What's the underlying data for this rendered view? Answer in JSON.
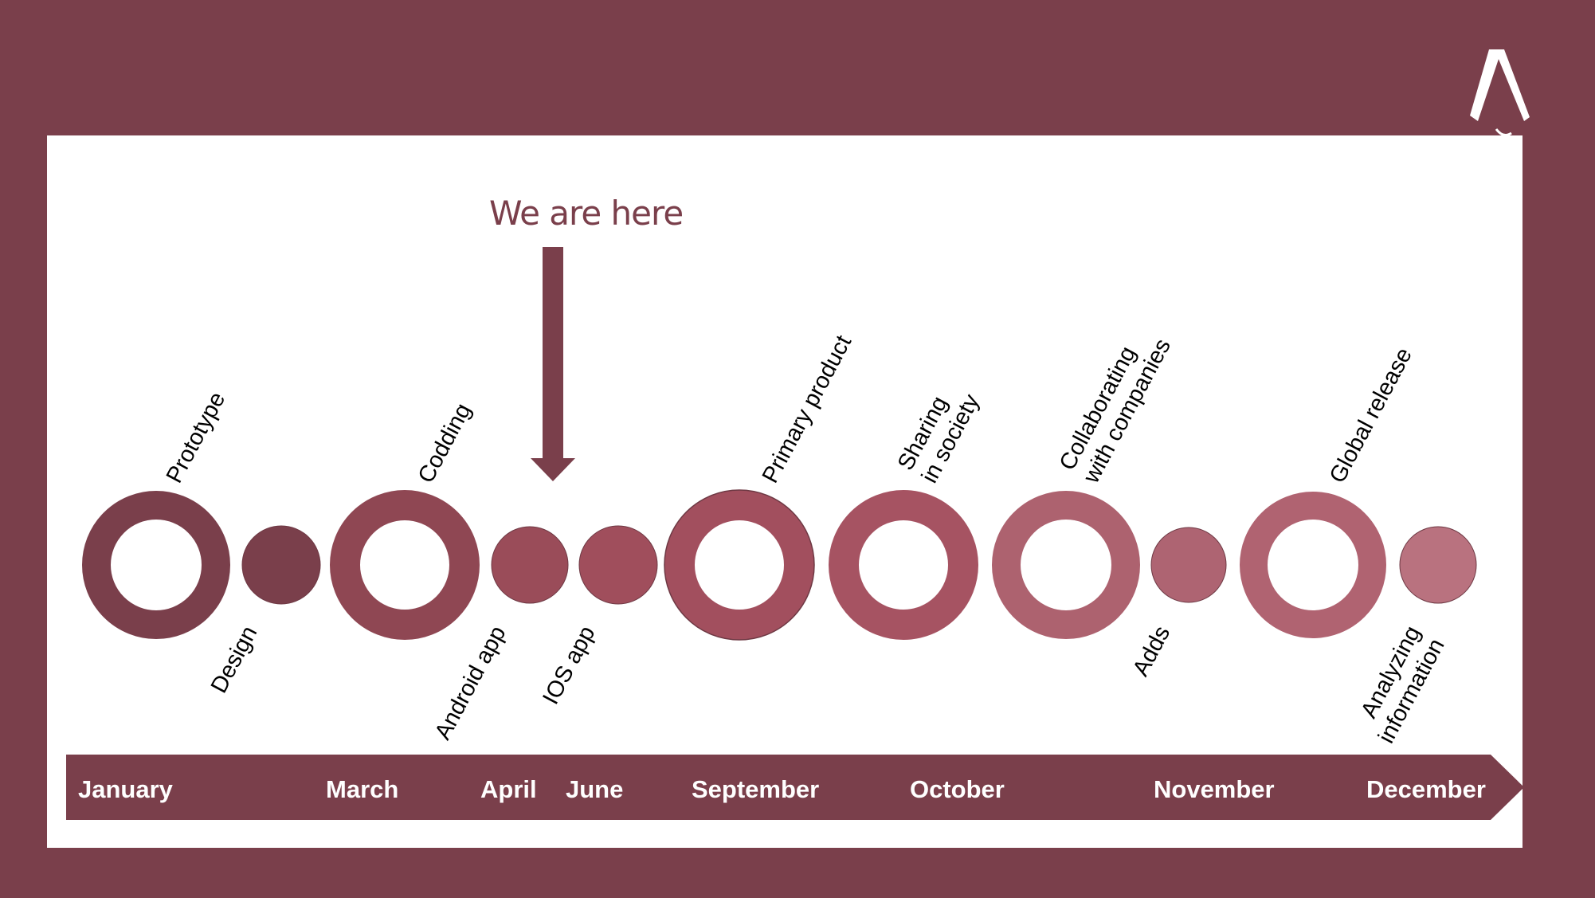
{
  "annotation": {
    "label": "We are here"
  },
  "stages": [
    {
      "name": "Prototype",
      "type": "milestone",
      "label_position": "above",
      "color": "#7a3f4b"
    },
    {
      "name": "Design",
      "type": "step",
      "label_position": "below",
      "color": "#7a3f4b"
    },
    {
      "name": "Codding",
      "type": "milestone",
      "label_position": "above",
      "color": "#8f4753"
    },
    {
      "name": "Android app",
      "type": "step",
      "label_position": "below",
      "color": "#9a4c59"
    },
    {
      "name": "IOS app",
      "type": "step",
      "label_position": "below",
      "color": "#a04e5c"
    },
    {
      "name": "Primary product",
      "type": "milestone",
      "label_position": "above",
      "color": "#a24f5e"
    },
    {
      "name": "Sharing in society",
      "type": "milestone",
      "label_position": "above",
      "color": "#a65362"
    },
    {
      "name": "Collaborating with companies",
      "type": "milestone",
      "label_position": "above",
      "color": "#ad626f"
    },
    {
      "name": "Adds",
      "type": "step",
      "label_position": "below",
      "color": "#ae6472"
    },
    {
      "name": "Global release",
      "type": "milestone",
      "label_position": "above",
      "color": "#b06371"
    },
    {
      "name": "Analyzing information",
      "type": "step",
      "label_position": "below",
      "color": "#b9727f"
    }
  ],
  "months": [
    "January",
    "March",
    "April",
    "June",
    "September",
    "October",
    "November",
    "December"
  ],
  "colors": {
    "background": "#7a3f4b",
    "panel": "#ffffff",
    "arrow": "#7a3f4b",
    "month_bar": "#7a3f4b"
  }
}
